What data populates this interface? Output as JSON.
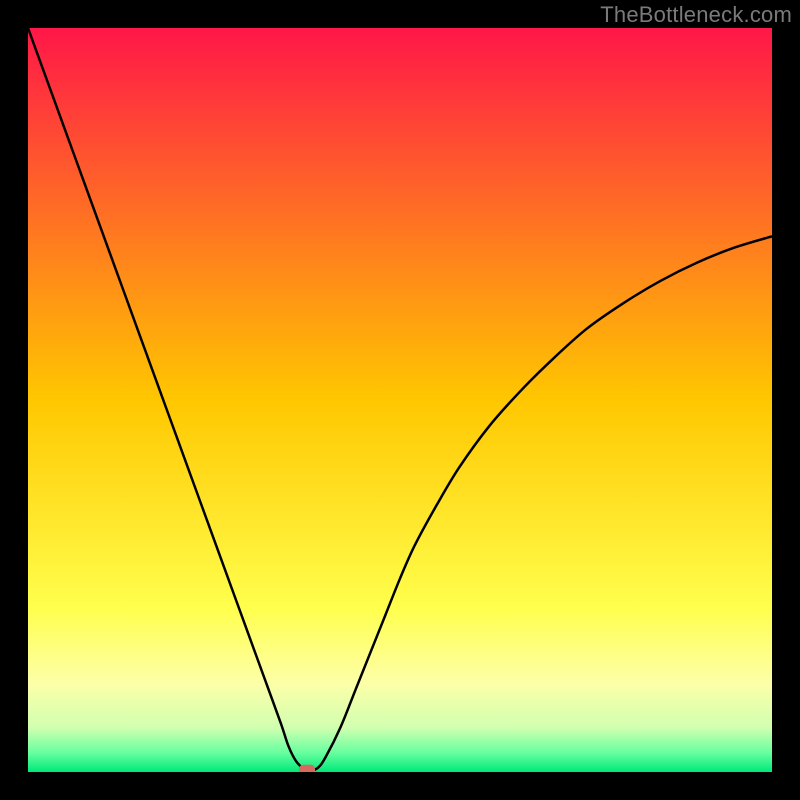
{
  "watermark": {
    "text": "TheBottleneck.com"
  },
  "chart_data": {
    "type": "line",
    "title": "",
    "xlabel": "",
    "ylabel": "",
    "xlim": [
      0,
      100
    ],
    "ylim": [
      0,
      100
    ],
    "background_gradient": {
      "stops": [
        {
          "pos": 0.0,
          "color": "#ff1748"
        },
        {
          "pos": 0.5,
          "color": "#ffc700"
        },
        {
          "pos": 0.78,
          "color": "#ffff4d"
        },
        {
          "pos": 0.88,
          "color": "#fdffa8"
        },
        {
          "pos": 0.94,
          "color": "#d2ffb0"
        },
        {
          "pos": 0.975,
          "color": "#64ff9f"
        },
        {
          "pos": 1.0,
          "color": "#00e878"
        }
      ]
    },
    "series": [
      {
        "name": "bottleneck-curve",
        "x": [
          0,
          2,
          4,
          6,
          8,
          10,
          12,
          14,
          16,
          18,
          20,
          22,
          24,
          26,
          28,
          30,
          32,
          34,
          35,
          36,
          37,
          38,
          39,
          40,
          42,
          44,
          46,
          48,
          50,
          52,
          55,
          58,
          62,
          66,
          70,
          75,
          80,
          85,
          90,
          95,
          100
        ],
        "values": [
          100,
          94.5,
          89,
          83.5,
          78,
          72.5,
          67,
          61.5,
          56,
          50.5,
          45,
          39.5,
          34,
          28.5,
          23,
          17.5,
          12,
          6.5,
          3.5,
          1.5,
          0.5,
          0.2,
          0.6,
          2,
          6,
          11,
          16,
          21,
          26,
          30.5,
          36,
          41,
          46.5,
          51,
          55,
          59.5,
          63,
          66,
          68.5,
          70.5,
          72
        ]
      }
    ],
    "marker": {
      "x": 37.5,
      "y": 0.3,
      "color": "#d66a5e"
    }
  }
}
